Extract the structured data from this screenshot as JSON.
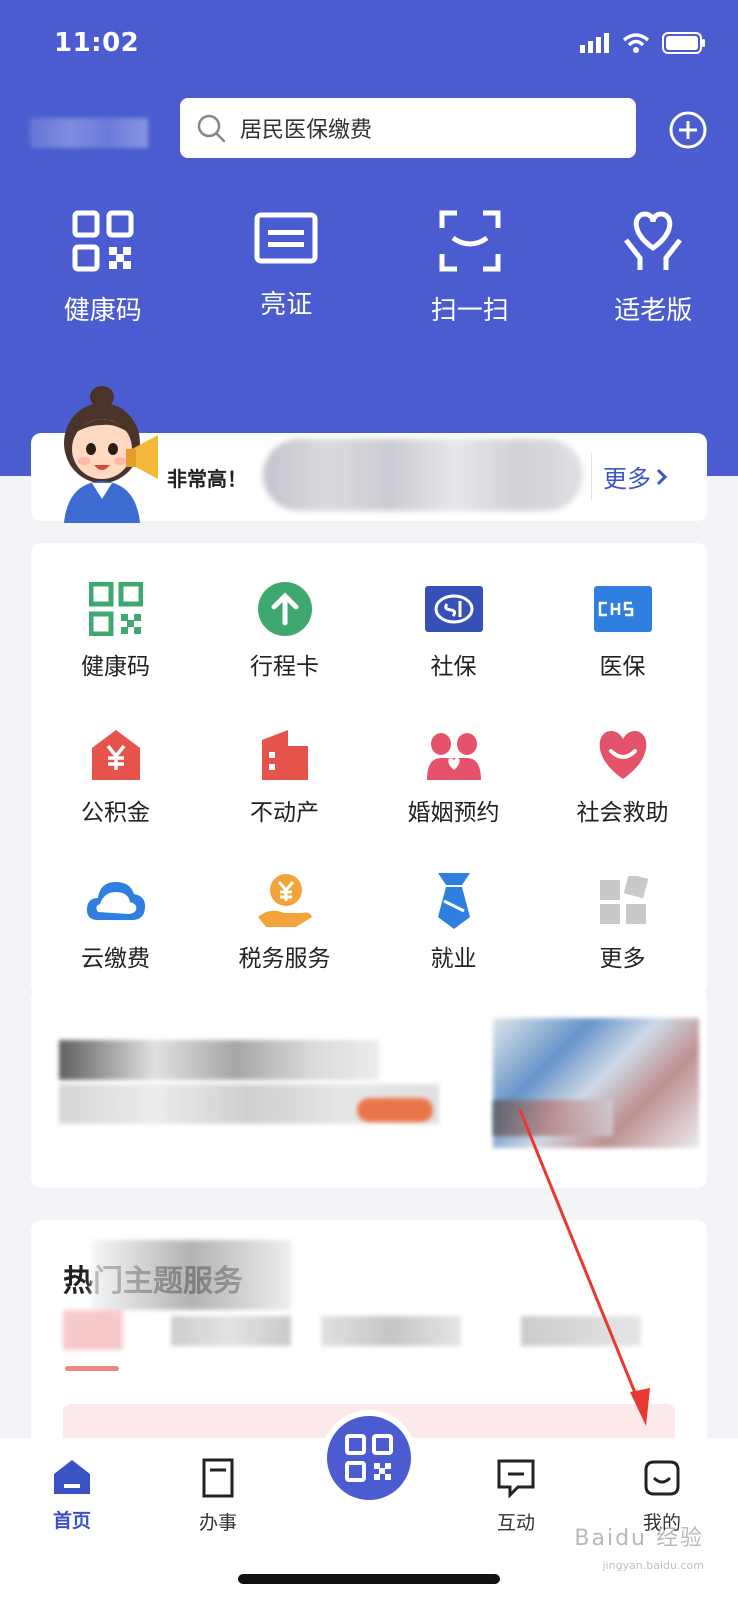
{
  "status": {
    "time": "11:02"
  },
  "search": {
    "placeholder": "居民医保缴费"
  },
  "quick_actions": [
    {
      "label": "健康码",
      "icon": "qr-code-icon"
    },
    {
      "label": "亮证",
      "icon": "id-card-icon"
    },
    {
      "label": "扫一扫",
      "icon": "scan-icon"
    },
    {
      "label": "适老版",
      "icon": "elder-heart-icon"
    }
  ],
  "notice": {
    "text": "非常高！",
    "more": "更多"
  },
  "services": [
    {
      "label": "健康码",
      "icon": "health-code-icon",
      "color": "#3ea86f"
    },
    {
      "label": "行程卡",
      "icon": "itinerary-arrow-icon",
      "color": "#3ea86f"
    },
    {
      "label": "社保",
      "icon": "social-security-icon",
      "color": "#3650b8"
    },
    {
      "label": "医保",
      "icon": "medical-insurance-icon",
      "color": "#2e7fe0"
    },
    {
      "label": "公积金",
      "icon": "housing-fund-icon",
      "color": "#e5534b"
    },
    {
      "label": "不动产",
      "icon": "real-estate-icon",
      "color": "#e5534b"
    },
    {
      "label": "婚姻预约",
      "icon": "marriage-icon",
      "color": "#e5536a"
    },
    {
      "label": "社会救助",
      "icon": "heart-smile-icon",
      "color": "#e5536a"
    },
    {
      "label": "云缴费",
      "icon": "cloud-icon",
      "color": "#2e7fe0"
    },
    {
      "label": "税务服务",
      "icon": "tax-coin-icon",
      "color": "#f2a33a"
    },
    {
      "label": "就业",
      "icon": "tie-icon",
      "color": "#2e7fe0"
    },
    {
      "label": "更多",
      "icon": "more-grid-icon",
      "color": "#c7c7c7"
    }
  ],
  "hot": {
    "title": "热门主题服务"
  },
  "tabs": [
    {
      "label": "首页",
      "icon": "home-icon"
    },
    {
      "label": "办事",
      "icon": "task-doc-icon"
    },
    {
      "label": "",
      "icon": "qr-code-icon"
    },
    {
      "label": "互动",
      "icon": "chat-icon"
    },
    {
      "label": "我的",
      "icon": "profile-smile-icon"
    }
  ],
  "colors": {
    "brand": "#4a5ccf",
    "accent_red": "#e5534b",
    "annotation_arrow": "#e8382f"
  },
  "watermark": {
    "text": "Baidu 经验",
    "sub": "jingyan.baidu.com"
  }
}
